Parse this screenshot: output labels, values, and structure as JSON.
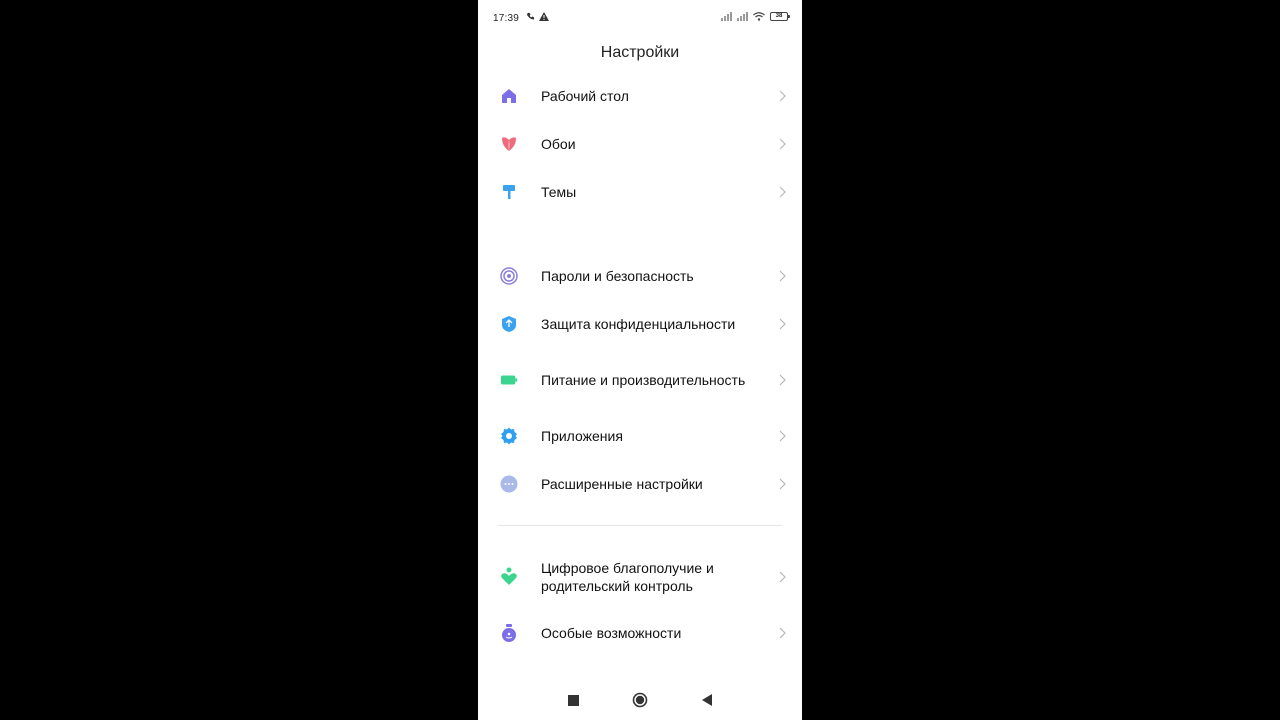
{
  "status_bar": {
    "time": "17:39",
    "battery": "38"
  },
  "header": {
    "title": "Настройки"
  },
  "groups": [
    {
      "items": [
        {
          "label": "Рабочий стол",
          "icon": "home-icon",
          "color": "#7c6ee6"
        },
        {
          "label": "Обои",
          "icon": "tulip-icon",
          "color": "#ef6b7b"
        },
        {
          "label": "Темы",
          "icon": "paint-roller-icon",
          "color": "#3aa2ee"
        }
      ]
    },
    {
      "items": [
        {
          "label": "Пароли и безопасность",
          "icon": "fingerprint-icon",
          "color": "#8a7fe0"
        },
        {
          "label": "Защита конфиденциальности",
          "icon": "shield-icon",
          "color": "#3aa2ee"
        },
        {
          "label": "Питание и производительность",
          "icon": "battery-icon",
          "color": "#3bd58f"
        },
        {
          "label": "Приложения",
          "icon": "gear-icon",
          "color": "#2f9ff0"
        },
        {
          "label": "Расширенные настройки",
          "icon": "more-dots-icon",
          "color": "#a9b9e8"
        }
      ]
    },
    {
      "items": [
        {
          "label": "Цифровое благополучие и родительский контроль",
          "icon": "wellbeing-heart-icon",
          "color": "#3bd58f"
        },
        {
          "label": "Особые возможности",
          "icon": "accessibility-icon",
          "color": "#7c6ee6"
        }
      ]
    }
  ],
  "nav_bar": {
    "buttons": [
      "recents-square-icon",
      "home-circle-icon",
      "back-triangle-icon"
    ]
  }
}
